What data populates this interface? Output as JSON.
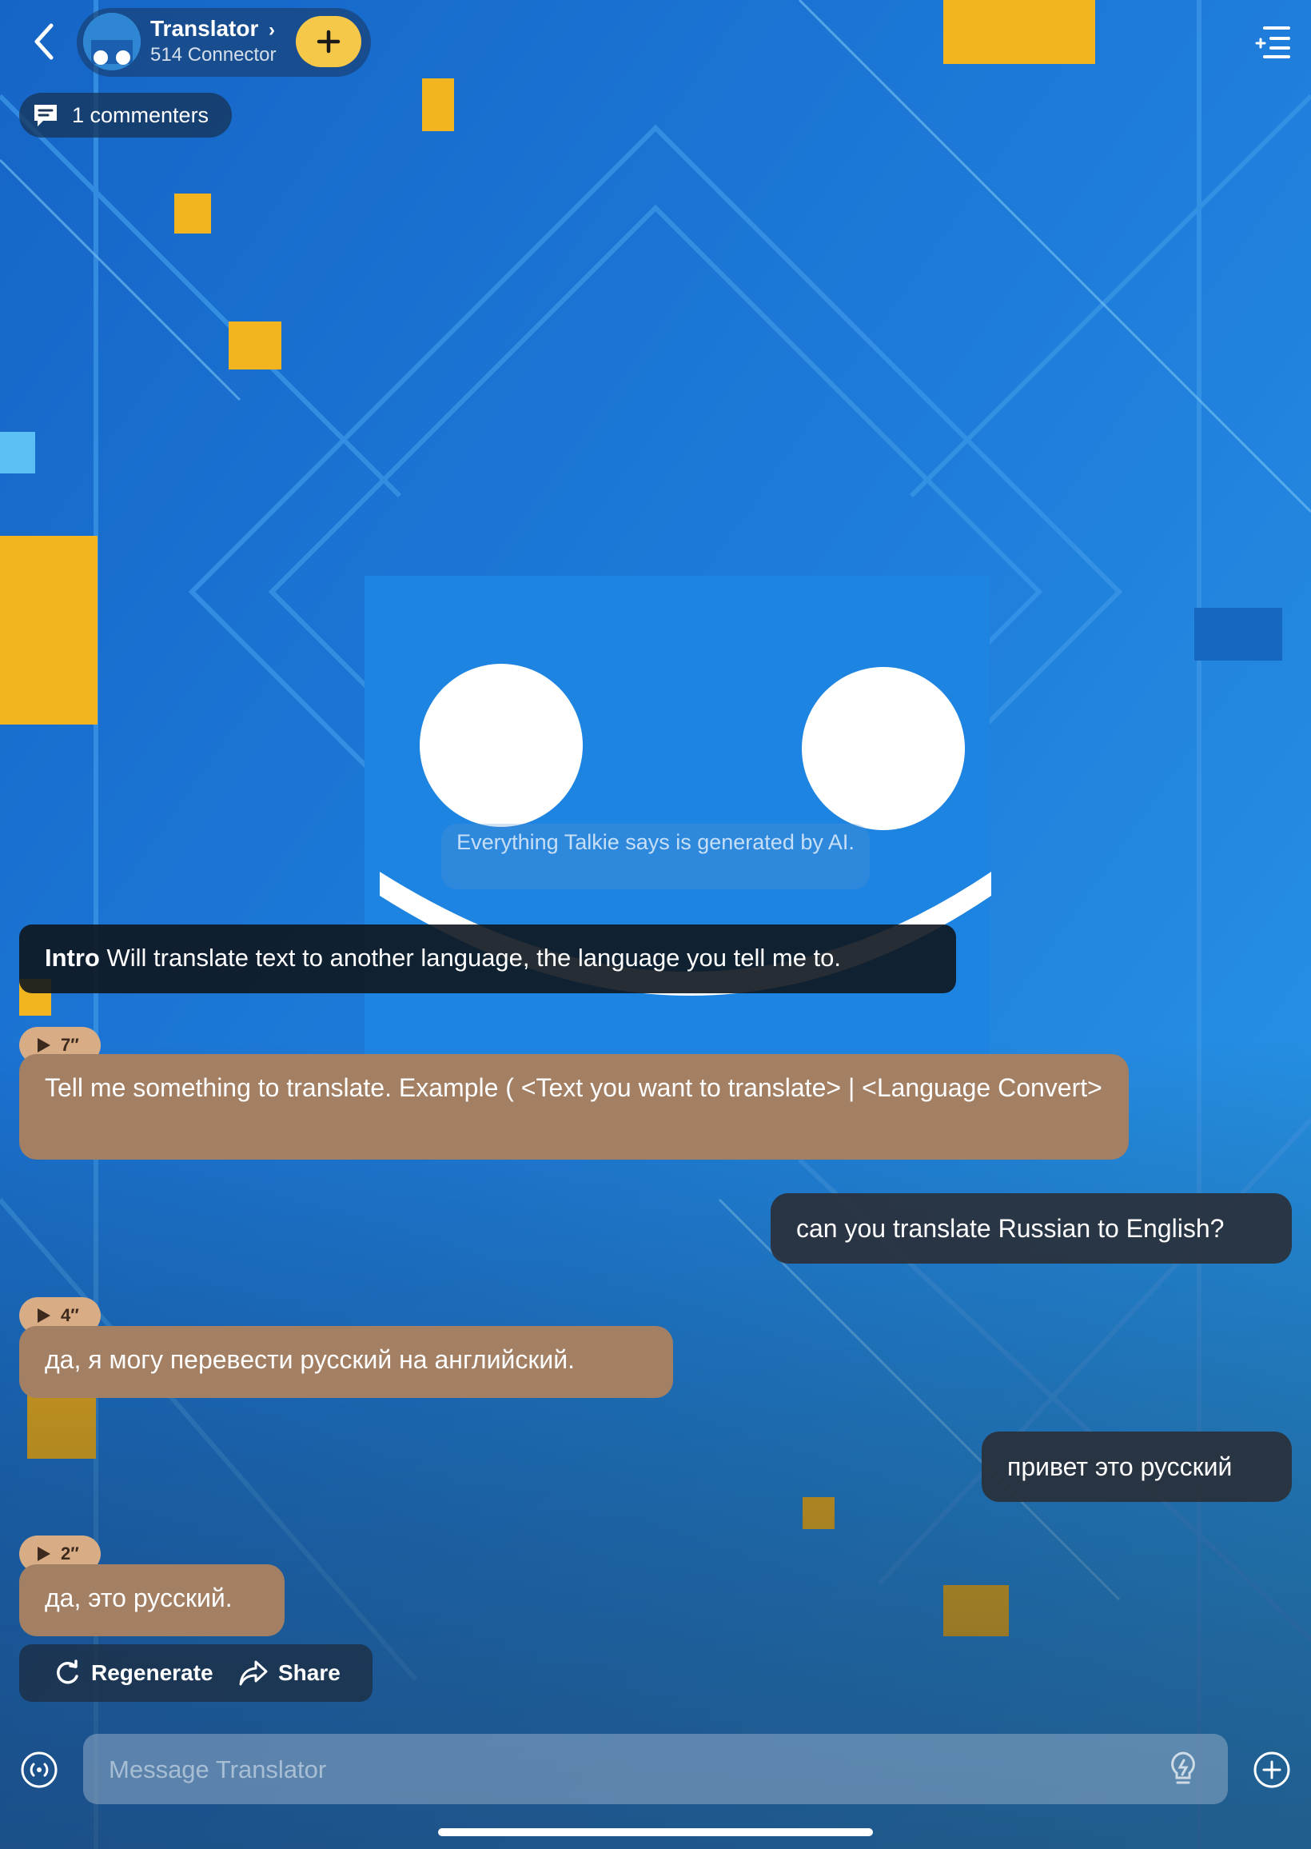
{
  "header": {
    "bot_name": "Translator",
    "bot_sub": "514 Connector",
    "commenters": "1 commenters"
  },
  "disclaimer": "Everything Talkie says is generated by AI.",
  "intro": {
    "label": "Intro",
    "text": "Will translate text to another language, the language you tell me to."
  },
  "messages": [
    {
      "role": "bot",
      "duration": "7″",
      "text": "Tell me something to translate. Example ( <Text you want to translate> | <Language Convert>"
    },
    {
      "role": "user",
      "text": "can you translate Russian to English?"
    },
    {
      "role": "bot",
      "duration": "4″",
      "text": "да, я могу перевести русский на английский."
    },
    {
      "role": "user",
      "text": "привет это русский"
    },
    {
      "role": "bot",
      "duration": "2″",
      "text": "да, это русский."
    }
  ],
  "actions": {
    "regenerate": "Regenerate",
    "share": "Share"
  },
  "composer": {
    "placeholder": "Message Translator"
  },
  "colors": {
    "bot_bubble": "#a37f63",
    "user_bubble": "#2a303a",
    "accent_yellow": "#f6c84a",
    "background_blue": "#1e78d6"
  }
}
